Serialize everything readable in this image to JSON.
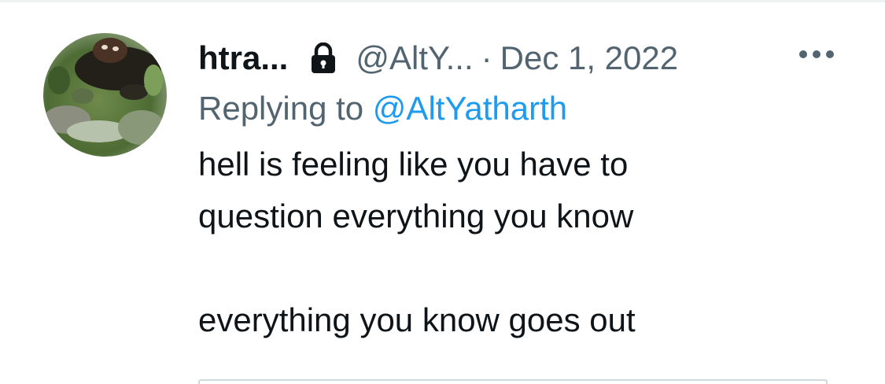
{
  "tweet": {
    "display_name": "htra...",
    "handle": "@AltY...",
    "separator": "·",
    "date": "Dec 1, 2022",
    "replying_prefix": "Replying to ",
    "replying_handle": "@AltYatharth",
    "body_lines": [
      "hell is feeling like you have to",
      "question everything you know",
      "",
      "everything you know goes out"
    ]
  },
  "icons": {
    "lock": "lock-icon",
    "more": "more-options-icon"
  },
  "colors": {
    "text": "#0f1419",
    "secondary": "#536471",
    "link": "#1d9bf0",
    "background": "#ffffff"
  }
}
